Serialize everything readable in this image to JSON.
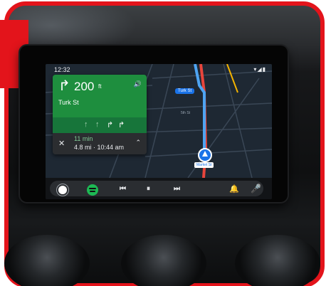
{
  "status_bar": {
    "time": "12:32",
    "icons": "▾◢▮"
  },
  "navigation": {
    "turn_icon": "turn-right-icon",
    "turn_glyph": "↱",
    "distance_value": "200",
    "distance_unit": "ft",
    "street": "Turk St",
    "volume_glyph": "🔊",
    "lanes": [
      "↑",
      "↑",
      "↱",
      "↱"
    ],
    "eta_minutes": "11 min",
    "eta_detail": "4.8 mi · 10:44 am",
    "close_glyph": "✕",
    "expand_glyph": "⌃"
  },
  "map": {
    "turk_label": "Turk St",
    "street_label_1": "5th St",
    "street_label_2": "",
    "market_label": "Market St"
  },
  "dock": {
    "prev_glyph": "⏮",
    "pause_glyph": "⏸",
    "next_glyph": "⏭",
    "bell_glyph": "🔔",
    "mic_glyph": "🎤"
  },
  "colors": {
    "frame": "#e3141b",
    "nav_green": "#1e8e3e",
    "route_blue": "#1a73e8",
    "spotify": "#1db954"
  }
}
